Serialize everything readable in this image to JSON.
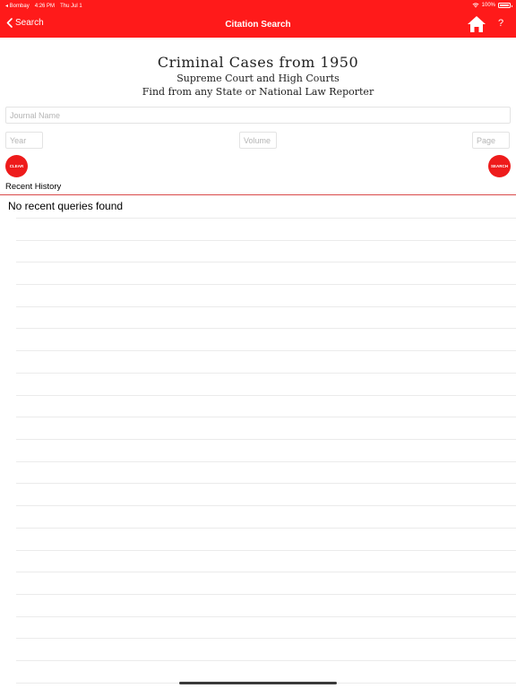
{
  "status_bar": {
    "carrier": "◂ Bombay",
    "time": "4:26 PM",
    "date": "Thu Jul 1",
    "battery": "100%"
  },
  "nav": {
    "back_label": "Search",
    "title": "Citation Search",
    "home_icon": "home-icon",
    "help_label": "?"
  },
  "header": {
    "title": "Criminal Cases from 1950",
    "subtitle": "Supreme Court and High Courts",
    "tagline": "Find from any State or National Law Reporter"
  },
  "form": {
    "journal_placeholder": "Journal Name",
    "year_placeholder": "Year",
    "volume_placeholder": "Volume",
    "page_placeholder": "Page",
    "clear_label": "CLEAR",
    "search_label": "SEARCH"
  },
  "history": {
    "label": "Recent History",
    "empty_message": "No recent queries found"
  },
  "colors": {
    "accent": "#ff1a1a",
    "button": "#ee1b1b"
  }
}
